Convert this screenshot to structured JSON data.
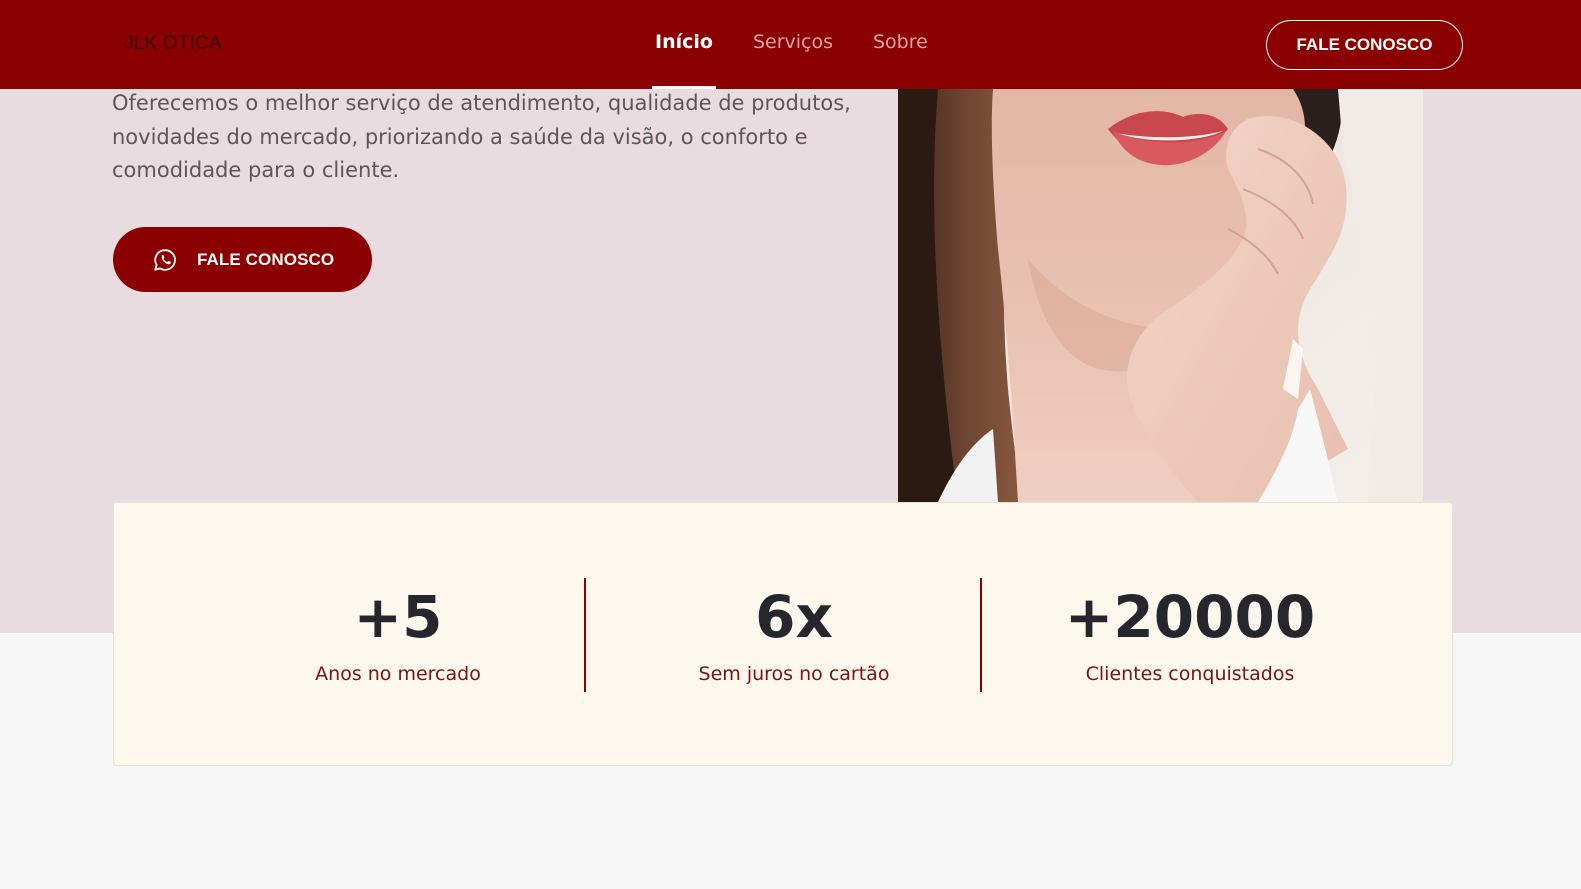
{
  "brand": {
    "logo_text": "JLK ÓTICA",
    "primary_color": "#8b0000",
    "hero_bg_color": "#e8dce1",
    "card_bg_color": "#fdf8ee"
  },
  "header": {
    "nav": [
      {
        "label": "Início",
        "active": true
      },
      {
        "label": "Serviços",
        "active": false
      },
      {
        "label": "Sobre",
        "active": false
      }
    ],
    "cta_label": "FALE CONOSCO"
  },
  "hero": {
    "description": "Oferecemos o melhor serviço de atendimento, qualidade de produtos, novidades do mercado, priorizando a saúde da visão, o conforto e comodidade para o cliente.",
    "cta_label": "FALE CONOSCO",
    "cta_icon": "whatsapp-icon"
  },
  "stats": [
    {
      "value": "+5",
      "label": "Anos no mercado"
    },
    {
      "value": "6x",
      "label": "Sem juros no cartão"
    },
    {
      "value": "+20000",
      "label": "Clientes conquistados"
    }
  ]
}
